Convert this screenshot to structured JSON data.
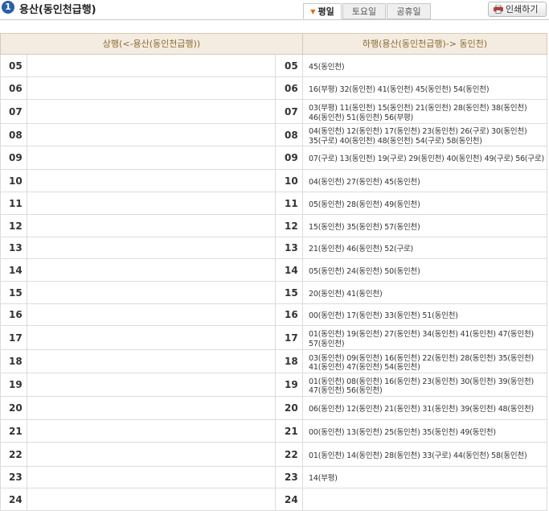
{
  "header": {
    "section_number": "1",
    "title": "용산(동인천급행)",
    "tabs": [
      {
        "label": "평일",
        "active": true
      },
      {
        "label": "토요일",
        "active": false
      },
      {
        "label": "공휴일",
        "active": false
      }
    ],
    "print_label": "인쇄하기"
  },
  "table": {
    "col_up": "상행(<-용산(동인천급행))",
    "col_down": "하행(용산(동인천급행)-> 동인천)",
    "rows": [
      {
        "hour": "05",
        "up": "",
        "down": "45(동인천)"
      },
      {
        "hour": "06",
        "up": "",
        "down": "16(부평) 32(동인천) 41(동인천) 45(동인천) 54(동인천)"
      },
      {
        "hour": "07",
        "up": "",
        "down": "03(부평) 11(동인천) 15(동인천) 21(동인천) 28(동인천) 38(동인천) 46(동인천) 51(동인천) 56(부평)"
      },
      {
        "hour": "08",
        "up": "",
        "down": "04(동인천) 12(동인천) 17(동인천) 23(동인천) 26(구로) 30(동인천) 35(구로) 40(동인천) 48(동인천) 54(구로) 58(동인천)"
      },
      {
        "hour": "09",
        "up": "",
        "down": "07(구로) 13(동인천) 19(구로) 29(동인천) 40(동인천) 49(구로) 56(구로)"
      },
      {
        "hour": "10",
        "up": "",
        "down": "04(동인천) 27(동인천) 45(동인천)"
      },
      {
        "hour": "11",
        "up": "",
        "down": "05(동인천) 28(동인천) 49(동인천)"
      },
      {
        "hour": "12",
        "up": "",
        "down": "15(동인천) 35(동인천) 57(동인천)"
      },
      {
        "hour": "13",
        "up": "",
        "down": "21(동인천) 46(동인천) 52(구로)"
      },
      {
        "hour": "14",
        "up": "",
        "down": "05(동인천) 24(동인천) 50(동인천)"
      },
      {
        "hour": "15",
        "up": "",
        "down": "20(동인천) 41(동인천)"
      },
      {
        "hour": "16",
        "up": "",
        "down": "00(동인천) 17(동인천) 33(동인천) 51(동인천)"
      },
      {
        "hour": "17",
        "up": "",
        "down": "01(동인천) 19(동인천) 27(동인천) 34(동인천) 41(동인천) 47(동인천) 57(동인천)"
      },
      {
        "hour": "18",
        "up": "",
        "down": "03(동인천) 09(동인천) 16(동인천) 22(동인천) 28(동인천) 35(동인천) 41(동인천) 47(동인천) 54(동인천)"
      },
      {
        "hour": "19",
        "up": "",
        "down": "01(동인천) 08(동인천) 16(동인천) 23(동인천) 30(동인천) 39(동인천) 47(동인천) 56(동인천)"
      },
      {
        "hour": "20",
        "up": "",
        "down": "06(동인천) 12(동인천) 21(동인천) 31(동인천) 39(동인천) 48(동인천)"
      },
      {
        "hour": "21",
        "up": "",
        "down": "00(동인천) 13(동인천) 25(동인천) 35(동인천) 49(동인천)"
      },
      {
        "hour": "22",
        "up": "",
        "down": "01(동인천) 14(동인천) 28(동인천) 33(구로) 44(동인천) 58(동인천)"
      },
      {
        "hour": "23",
        "up": "",
        "down": "14(부평)"
      },
      {
        "hour": "24",
        "up": "",
        "down": ""
      }
    ]
  }
}
